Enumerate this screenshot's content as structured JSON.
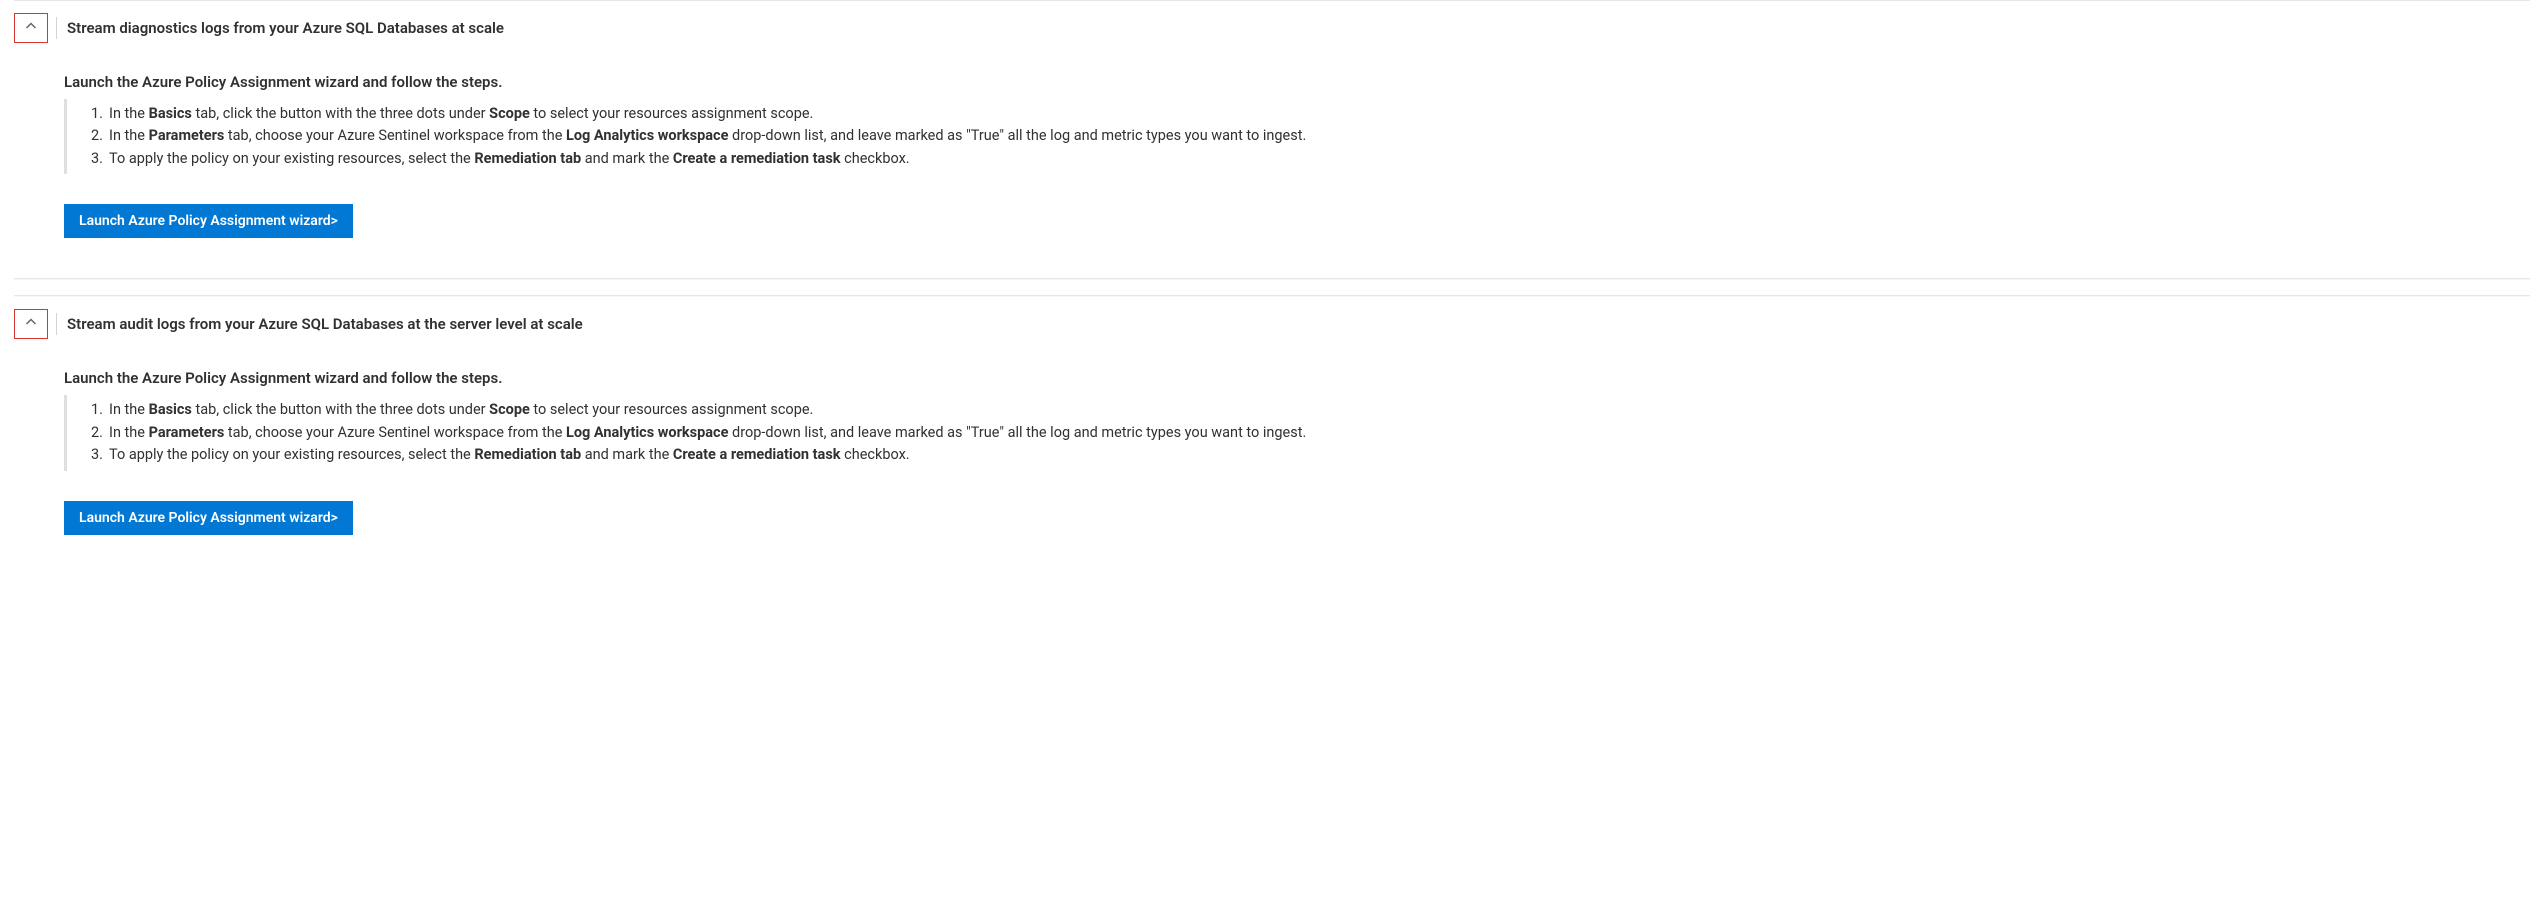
{
  "sections": [
    {
      "title": "Stream diagnostics logs from your Azure SQL Databases at scale",
      "lead": "Launch the Azure Policy Assignment wizard and follow the steps.",
      "steps": [
        {
          "num": "1.",
          "pre": "In the ",
          "b1": "Basics",
          "mid1": " tab, click the button with the three dots under ",
          "b2": "Scope",
          "post": " to select your resources assignment scope."
        },
        {
          "num": "2.",
          "pre": "In the ",
          "b1": "Parameters",
          "mid1": " tab, choose your Azure Sentinel workspace from the ",
          "b2": "Log Analytics workspace",
          "post": " drop-down list, and leave marked as \"True\" all the log and metric types you want to ingest."
        },
        {
          "num": "3.",
          "pre": "To apply the policy on your existing resources, select the ",
          "b1": "Remediation tab",
          "mid1": " and mark the ",
          "b2": "Create a remediation task",
          "post": " checkbox."
        }
      ],
      "button": "Launch Azure Policy Assignment wizard>"
    },
    {
      "title": "Stream audit logs from your Azure SQL Databases at the server level at scale",
      "lead": "Launch the Azure Policy Assignment wizard and follow the steps.",
      "steps": [
        {
          "num": "1.",
          "pre": "In the ",
          "b1": "Basics",
          "mid1": " tab, click the button with the three dots under ",
          "b2": "Scope",
          "post": " to select your resources assignment scope."
        },
        {
          "num": "2.",
          "pre": "In the ",
          "b1": "Parameters",
          "mid1": " tab, choose your Azure Sentinel workspace from the ",
          "b2": "Log Analytics workspace",
          "post": " drop-down list, and leave marked as \"True\" all the log and metric types you want to ingest."
        },
        {
          "num": "3.",
          "pre": "To apply the policy on your existing resources, select the ",
          "b1": "Remediation tab",
          "mid1": " and mark the ",
          "b2": "Create a remediation task",
          "post": " checkbox."
        }
      ],
      "button": "Launch Azure Policy Assignment wizard>"
    }
  ]
}
